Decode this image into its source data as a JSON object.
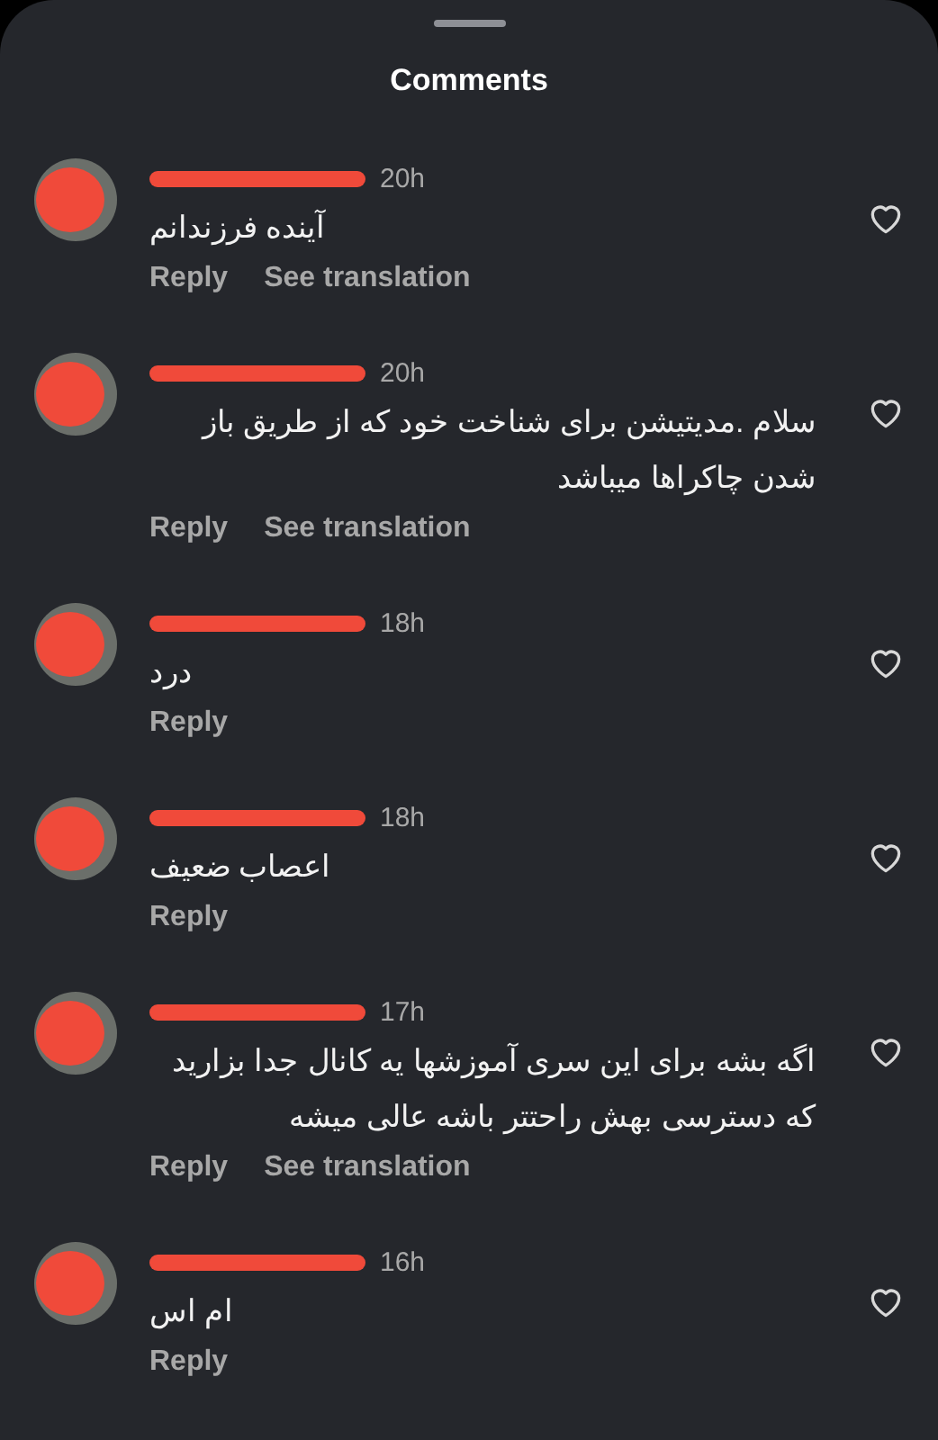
{
  "sheet": {
    "title": "Comments"
  },
  "comments": [
    {
      "time": "20h",
      "text": "آینده فرزندانم",
      "reply_label": "Reply",
      "translate_label": "See translation",
      "liked": false
    },
    {
      "time": "20h",
      "text": "سلام .مدیتیشن برای شناخت خود که از طریق باز شدن چاکراها میباشد",
      "reply_label": "Reply",
      "translate_label": "See translation",
      "liked": false
    },
    {
      "time": "18h",
      "text": "درد",
      "reply_label": "Reply",
      "liked": false
    },
    {
      "time": "18h",
      "text": "اعصاب ضعیف",
      "reply_label": "Reply",
      "liked": false
    },
    {
      "time": "17h",
      "text": "اگه بشه برای این سری آموزشها یه کانال جدا بزارید که دسترسی بهش راحتتر باشه عالی میشه",
      "reply_label": "Reply",
      "translate_label": "See translation",
      "liked": false
    },
    {
      "time": "16h",
      "text": "ام اس",
      "reply_label": "Reply",
      "liked": false
    }
  ]
}
